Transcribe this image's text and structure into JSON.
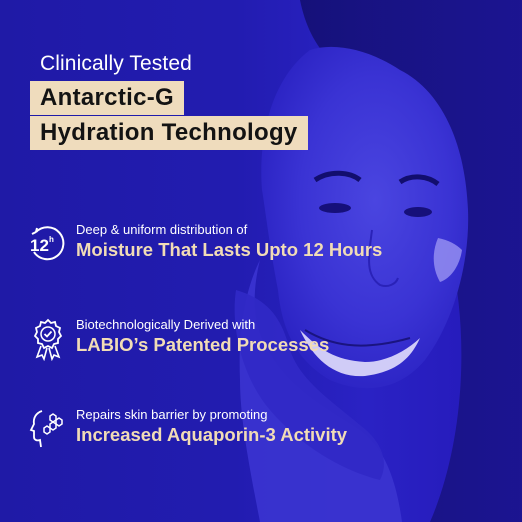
{
  "header": {
    "eyebrow": "Clinically Tested",
    "headline_line1": "Antarctic-G",
    "headline_line2": "Hydration Technology"
  },
  "features": [
    {
      "icon": "12-hour-clock-icon",
      "icon_text": "12",
      "icon_superscript": "h",
      "subtitle": "Deep & uniform distribution of",
      "title": "Moisture That Lasts Upto 12 Hours"
    },
    {
      "icon": "patent-badge-icon",
      "subtitle": "Biotechnologically Derived with",
      "title": "LABIO’s Patented Processes"
    },
    {
      "icon": "head-molecule-icon",
      "subtitle": "Repairs skin barrier by promoting",
      "title": "Increased Aquaporin-3 Activity"
    }
  ],
  "colors": {
    "background": "#221cb0",
    "highlight_bg": "#efdcbd",
    "highlight_text": "#131313",
    "feature_title": "#f1dcb6",
    "white": "#ffffff"
  }
}
